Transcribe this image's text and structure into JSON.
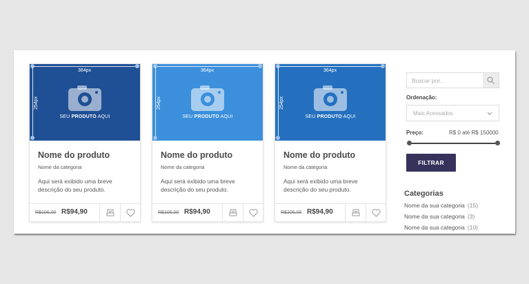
{
  "products": [
    {
      "image_width_label": "364px",
      "image_height_label": "254px",
      "placeholder_pre": "SEU ",
      "placeholder_bold": "PRODUTO",
      "placeholder_post": " AQUI",
      "name": "Nome do produto",
      "category": "Nome da categoria",
      "description": "Aqui será exibido uma breve descrição do seu produto.",
      "old_price": "R$106,00",
      "price": "R$94,90",
      "color": "#1f4f94"
    },
    {
      "image_width_label": "364px",
      "image_height_label": "254px",
      "placeholder_pre": "SEU ",
      "placeholder_bold": "PRODUTO",
      "placeholder_post": " AQUI",
      "name": "Nome do produto",
      "category": "Nome da categoria",
      "description": "Aqui será exibido uma breve descrição do seu produto.",
      "old_price": "R$106,00",
      "price": "R$94,90",
      "color": "#3b8fdb"
    },
    {
      "image_width_label": "364px",
      "image_height_label": "254px",
      "placeholder_pre": "SEU ",
      "placeholder_bold": "PRODUTO",
      "placeholder_post": " AQUI",
      "name": "Nome do produto",
      "category": "Nome da categoria",
      "description": "Aqui será exibido uma breve descrição do seu produto.",
      "old_price": "R$106,00",
      "price": "R$94,90",
      "color": "#2470bf"
    }
  ],
  "icons": {
    "image": "camera-icon",
    "compare": "compare-icon",
    "wishlist": "heart-icon",
    "search": "search-icon",
    "dropdown": "chevron-down-icon"
  },
  "sidebar": {
    "search_placeholder": "Buscar por...",
    "sort_label": "Ordenação:",
    "sort_value": "Mais Acessados",
    "price_label": "Preço:",
    "price_range": "R$ 0 até R$ 150000",
    "filter_button": "FILTRAR",
    "categories_title": "Categorias",
    "categories": [
      {
        "name": "Nome da sua categoria",
        "count": "(15)"
      },
      {
        "name": "Nome da sua categoria",
        "count": "(3)"
      },
      {
        "name": "Nome da sua categoria",
        "count": "(10)"
      }
    ]
  },
  "colors": {
    "button": "#37325c",
    "page_bg": "#e6e6e6"
  }
}
